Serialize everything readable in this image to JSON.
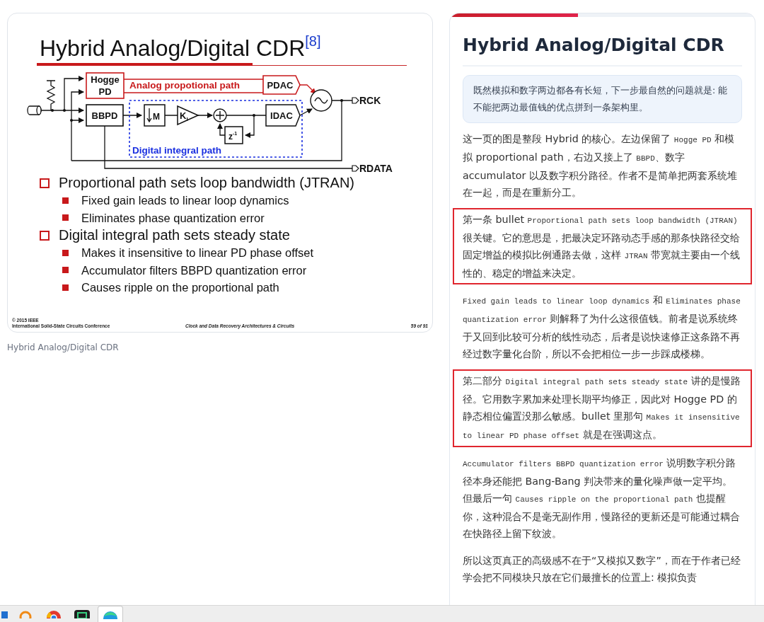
{
  "slide": {
    "title": "Hybrid Analog/Digital CDR",
    "citation": "[8]",
    "diagram": {
      "hogge_pd": [
        "Hogge",
        "PD"
      ],
      "analog_path_label": "Analog propotional path",
      "pdac": "PDAC",
      "bbpd": "BBPD",
      "decimator": "M",
      "gain": "K",
      "gain_subscript": "I",
      "delay": "z",
      "delay_exponent": "-1",
      "idac": "IDAC",
      "digital_path_label": "Digital integral path",
      "clock_output": "RCK",
      "data_output": "RDATA"
    },
    "bullets": [
      {
        "text": "Proportional path sets loop bandwidth (JTRAN)",
        "children": [
          {
            "text": "Fixed gain leads to linear loop dynamics"
          },
          {
            "text": "Eliminates phase quantization error"
          }
        ]
      },
      {
        "text": "Digital integral path sets steady state",
        "children": [
          {
            "text": "Makes it insensitive to linear PD phase offset"
          },
          {
            "text": "Accumulator filters BBPD quantization error"
          },
          {
            "text": "Causes ripple on the proportional path"
          }
        ]
      }
    ],
    "footer": {
      "copyright": "© 2015 IEEE",
      "conference": "International Solid-State Circuits Conference",
      "course": "Clock and Data Recovery Architectures & Circuits",
      "page": "59 of 91"
    }
  },
  "slide_caption": "Hybrid Analog/Digital CDR",
  "article": {
    "reading_progress": {
      "level": 0.42
    },
    "title": "Hybrid Analog/Digital CDR",
    "callout": "既然模拟和数字两边都各有长短，下一步最自然的问题就是: 能不能把两边最值钱的优点拼到一条架构里。",
    "paragraphs": [
      {
        "highlighted": false,
        "segments": [
          {
            "kind": "text",
            "text": "这一页的图是整段 Hybrid 的核心。左边保留了 "
          },
          {
            "kind": "code",
            "text": "Hogge PD"
          },
          {
            "kind": "text",
            "text": " 和模拟 proportional path，右边又接上了 "
          },
          {
            "kind": "code",
            "text": "BBPD"
          },
          {
            "kind": "text",
            "text": "、数字 accumulator 以及数字积分路径。作者不是简单把两套系统堆在一起，而是在重新分工。"
          }
        ]
      },
      {
        "highlighted": true,
        "segments": [
          {
            "kind": "text",
            "text": "第一条 bullet "
          },
          {
            "kind": "code",
            "text": "Proportional path sets loop bandwidth (JTRAN)"
          },
          {
            "kind": "text",
            "text": " 很关键。它的意思是，把最决定环路动态手感的那条快路径交给固定增益的模拟比例通路去做，这样 "
          },
          {
            "kind": "code",
            "text": "JTRAN"
          },
          {
            "kind": "text",
            "text": " 带宽就主要由一个线性的、稳定的增益来决定。"
          }
        ]
      },
      {
        "highlighted": false,
        "segments": [
          {
            "kind": "code",
            "text": "Fixed gain leads to linear loop dynamics"
          },
          {
            "kind": "text",
            "text": " 和 "
          },
          {
            "kind": "code",
            "text": "Eliminates phase quantization error"
          },
          {
            "kind": "text",
            "text": " 则解释了为什么这很值钱。前者是说系统终于又回到比较可分析的线性动态，后者是说快速修正这条路不再经过数字量化台阶，所以不会把相位一步一步踩成楼梯。"
          }
        ]
      },
      {
        "highlighted": true,
        "segments": [
          {
            "kind": "text",
            "text": "第二部分 "
          },
          {
            "kind": "code",
            "text": "Digital integral path sets steady state"
          },
          {
            "kind": "text",
            "text": " 讲的是慢路径。它用数字累加来处理长期平均修正，因此对 Hogge PD 的静态相位偏置没那么敏感。bullet 里那句 "
          },
          {
            "kind": "code",
            "text": "Makes it insensitive to linear PD phase offset"
          },
          {
            "kind": "text",
            "text": " 就是在强调这点。"
          }
        ]
      },
      {
        "highlighted": false,
        "segments": [
          {
            "kind": "code",
            "text": "Accumulator filters BBPD quantization error"
          },
          {
            "kind": "text",
            "text": " 说明数字积分路径本身还能把 Bang-Bang 判决带来的量化噪声做一定平均。但最后一句 "
          },
          {
            "kind": "code",
            "text": "Causes ripple on the proportional path"
          },
          {
            "kind": "text",
            "text": " 也提醒你，这种混合不是毫无副作用，慢路径的更新还是可能通过耦合在快路径上留下纹波。"
          }
        ]
      },
      {
        "highlighted": false,
        "segments": [
          {
            "kind": "text",
            "text": "所以这页真正的高级感不在于“又模拟又数字”，而在于作者已经学会把不同模块只放在它们最擅长的位置上: 模拟负责"
          }
        ]
      }
    ]
  },
  "taskbar": {
    "apps": [
      {
        "kind": "tile",
        "active": false
      },
      {
        "kind": "ring",
        "active": false
      },
      {
        "kind": "browser",
        "active": false
      },
      {
        "kind": "terminal",
        "active": false
      },
      {
        "kind": "globe",
        "active": true
      }
    ]
  }
}
